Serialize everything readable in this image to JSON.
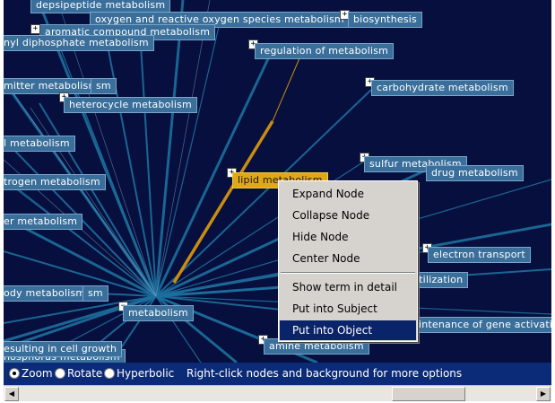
{
  "graph": {
    "nodes": {
      "depsipeptide": "depsipeptide metabolism",
      "oxygen": "oxygen and reactive oxygen species metabolism",
      "biosynthesis": "biosynthesis",
      "aromatic": "aromatic compound metabolism",
      "diphosphate": "nyl diphosphate metabolism",
      "regulation": "regulation of metabolism",
      "carbohydrate": "carbohydrate metabolism",
      "transmitter": "mitter metabolism",
      "transmitter_tail": "sm",
      "heterocycle": "heterocycle metabolism",
      "left_metabolism": "l metabolism",
      "sulfur": "sulfur metabolism",
      "drug": "drug metabolism",
      "nitrogen": "trogen metabolism",
      "lipid": "lipid metabolism",
      "er_metabolism": "er metabolism",
      "electron": "electron transport",
      "utilization": "utilization",
      "body": "ody metabolism",
      "body_tail": "sm",
      "metabolism": "metabolism",
      "maintenance": "aintenance of gene activation",
      "growth": "esulting in cell growth",
      "phosphorus": "hosphorus metabolism",
      "amine": "amine metabolism"
    }
  },
  "context_menu": {
    "items": [
      "Expand Node",
      "Collapse Node",
      "Hide Node",
      "Center Node",
      "Show term in detail",
      "Put into Subject",
      "Put into Object"
    ],
    "active_index": 6
  },
  "toolbar": {
    "mode_zoom": "Zoom",
    "mode_rotate": "Rotate",
    "mode_hyperbolic": "Hyperbolic",
    "selected_mode": "Zoom",
    "hint": "Right-click nodes and background for more options"
  },
  "colors": {
    "background": "#060f3e",
    "node": "#3a6f9b",
    "selected_node": "#e0a814",
    "edge": "#1d6f9c",
    "highlight_edge": "#c98d10",
    "menu_highlight": "#0a246a"
  }
}
